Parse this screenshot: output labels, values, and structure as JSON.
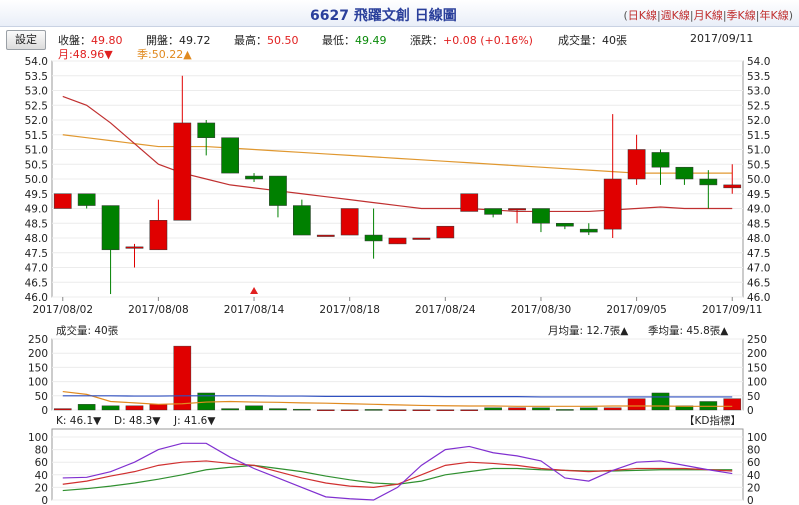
{
  "title": "6627 飛躍文創  日線圖",
  "tabs": [
    "日K線",
    "週K線",
    "月K線",
    "季K線",
    "年K線"
  ],
  "settings_label": "設定",
  "quote": {
    "close_label": "收盤：",
    "close": "49.80",
    "open_label": "開盤：",
    "open": "49.72",
    "high_label": "最高：",
    "high": "50.50",
    "low_label": "最低：",
    "low": "49.49",
    "change_label": "漲跌：",
    "change": "+0.08",
    "change_pct": "(+0.16%)",
    "volume_text": "成交量：40張",
    "date": "2017/09/11",
    "month_ma": "月:48.96▼",
    "season_ma": "季:50.22▲"
  },
  "colors": {
    "up": "#e00000",
    "down": "#008000",
    "month_ma": "#c03030",
    "season_ma": "#e09830",
    "kd_k": "#d03030",
    "kd_d": "#309030",
    "kd_j": "#8030d0"
  },
  "chart_data": [
    {
      "type": "candlestick",
      "dates": [
        "2017/08/02",
        "2017/08/03",
        "2017/08/04",
        "2017/08/07",
        "2017/08/08",
        "2017/08/09",
        "2017/08/10",
        "2017/08/11",
        "2017/08/14",
        "2017/08/15",
        "2017/08/16",
        "2017/08/17",
        "2017/08/18",
        "2017/08/21",
        "2017/08/22",
        "2017/08/23",
        "2017/08/24",
        "2017/08/25",
        "2017/08/28",
        "2017/08/29",
        "2017/08/30",
        "2017/08/31",
        "2017/09/01",
        "2017/09/04",
        "2017/09/05",
        "2017/09/06",
        "2017/09/07",
        "2017/09/08",
        "2017/09/11"
      ],
      "x_tick_labels": [
        "2017/08/02",
        "2017/08/08",
        "2017/08/14",
        "2017/08/18",
        "2017/08/24",
        "2017/08/30",
        "2017/09/05",
        "2017/09/11"
      ],
      "open": [
        49.0,
        49.5,
        49.1,
        47.7,
        47.6,
        48.6,
        51.9,
        51.4,
        50.1,
        50.1,
        49.1,
        48.1,
        48.1,
        48.1,
        47.8,
        48.0,
        48.0,
        48.9,
        49.0,
        49.0,
        49.0,
        48.5,
        48.3,
        48.3,
        50.0,
        50.9,
        50.4,
        50.0,
        49.7
      ],
      "high": [
        49.5,
        49.5,
        49.1,
        47.8,
        49.3,
        53.5,
        52.0,
        51.4,
        50.2,
        50.1,
        49.3,
        48.1,
        49.0,
        49.0,
        48.0,
        48.0,
        48.4,
        49.5,
        49.0,
        49.0,
        49.0,
        48.5,
        48.5,
        52.2,
        51.5,
        51.0,
        50.4,
        50.3,
        50.5
      ],
      "low": [
        49.0,
        49.0,
        46.1,
        47.0,
        47.6,
        48.6,
        50.8,
        50.2,
        49.9,
        48.7,
        48.1,
        48.1,
        48.1,
        47.3,
        47.8,
        48.0,
        48.0,
        48.9,
        48.7,
        48.5,
        48.2,
        48.3,
        48.1,
        48.0,
        49.8,
        49.8,
        49.8,
        49.0,
        49.5
      ],
      "close": [
        49.5,
        49.1,
        47.6,
        47.7,
        48.6,
        51.9,
        51.4,
        50.2,
        50.0,
        49.1,
        48.1,
        48.1,
        49.0,
        47.9,
        48.0,
        48.0,
        48.4,
        49.5,
        48.8,
        49.0,
        48.5,
        48.4,
        48.2,
        50.0,
        51.0,
        50.4,
        50.0,
        49.8,
        49.8
      ],
      "month_ma": [
        52.8,
        52.5,
        51.9,
        51.2,
        50.5,
        50.2,
        50.0,
        49.8,
        49.7,
        49.6,
        49.5,
        49.4,
        49.3,
        49.2,
        49.1,
        49.0,
        49.0,
        49.0,
        48.95,
        48.9,
        48.9,
        48.9,
        48.9,
        48.95,
        49.0,
        49.05,
        49.0,
        49.0,
        49.0
      ],
      "season_ma": [
        51.5,
        51.4,
        51.3,
        51.2,
        51.1,
        51.1,
        51.1,
        51.05,
        51.0,
        50.95,
        50.9,
        50.85,
        50.8,
        50.75,
        50.7,
        50.65,
        50.6,
        50.55,
        50.5,
        50.45,
        50.4,
        50.35,
        50.3,
        50.25,
        50.2,
        50.2,
        50.2,
        50.2,
        50.2
      ],
      "ylim": [
        46.0,
        54.0
      ],
      "y_ticks": [
        "46.0",
        "46.5",
        "47.0",
        "47.5",
        "48.0",
        "48.5",
        "49.0",
        "49.5",
        "50.0",
        "50.5",
        "51.0",
        "51.5",
        "52.0",
        "52.5",
        "53.0",
        "53.5",
        "54.0"
      ]
    },
    {
      "type": "bar",
      "title": "成交量: 40張",
      "legend": [
        "月均量: 12.7張▲",
        "季均量: 45.8張▲"
      ],
      "values": [
        5,
        20,
        15,
        15,
        20,
        225,
        60,
        5,
        15,
        5,
        3,
        1,
        1,
        2,
        1,
        1,
        1,
        1,
        8,
        8,
        8,
        2,
        8,
        8,
        40,
        60,
        15,
        30,
        40
      ],
      "month_avg": [
        65,
        55,
        30,
        25,
        20,
        22,
        28,
        30,
        28,
        27,
        25,
        24,
        22,
        20,
        18,
        16,
        15,
        14,
        14,
        13,
        13,
        13,
        13,
        14,
        14,
        14,
        13,
        13,
        13
      ],
      "season_avg": [
        50,
        50,
        50,
        49,
        49,
        50,
        50,
        50,
        50,
        49,
        49,
        48,
        48,
        48,
        48,
        48,
        47,
        47,
        47,
        47,
        46,
        46,
        46,
        46,
        46,
        46,
        46,
        46,
        46
      ],
      "ylim": [
        0,
        250
      ],
      "y_ticks": [
        "0",
        "50",
        "100",
        "150",
        "200",
        "250"
      ]
    },
    {
      "type": "line",
      "label": "KD指標",
      "legend": [
        "K: 46.1▼",
        "D: 48.3▼",
        "J: 41.6▼"
      ],
      "K": [
        25,
        30,
        38,
        45,
        55,
        60,
        62,
        58,
        55,
        45,
        35,
        27,
        22,
        20,
        25,
        40,
        55,
        60,
        58,
        55,
        50,
        47,
        45,
        47,
        50,
        50,
        50,
        48,
        46
      ],
      "D": [
        15,
        18,
        22,
        27,
        33,
        40,
        48,
        52,
        55,
        50,
        45,
        38,
        32,
        27,
        25,
        30,
        40,
        45,
        50,
        50,
        48,
        47,
        46,
        46,
        47,
        48,
        48,
        48,
        48
      ],
      "J": [
        35,
        36,
        45,
        60,
        80,
        90,
        90,
        68,
        50,
        35,
        20,
        5,
        2,
        0,
        20,
        55,
        80,
        85,
        75,
        70,
        62,
        35,
        30,
        47,
        60,
        62,
        55,
        48,
        42
      ],
      "ylim": [
        0,
        100
      ],
      "y_ticks": [
        "0",
        "20",
        "40",
        "60",
        "80",
        "100"
      ]
    }
  ]
}
